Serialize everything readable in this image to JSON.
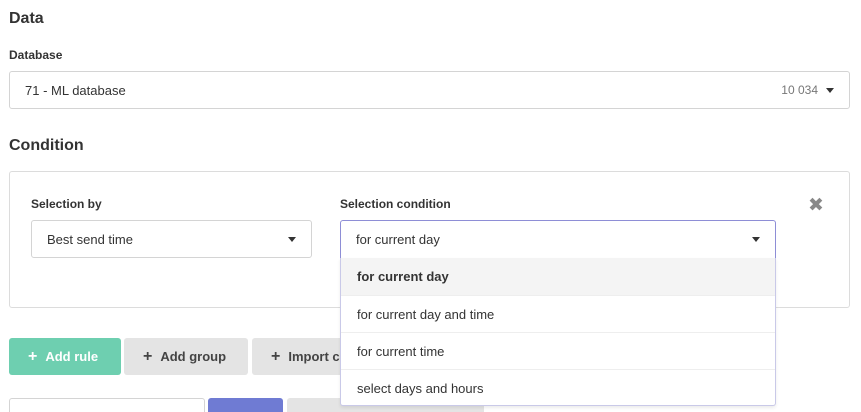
{
  "data_section": {
    "title": "Data",
    "database_label": "Database",
    "database_value": "71 - ML database",
    "database_count": "10 034"
  },
  "condition_section": {
    "title": "Condition",
    "selection_by_label": "Selection by",
    "selection_by_value": "Best send time",
    "selection_condition_label": "Selection condition",
    "selection_condition_value": "for current day",
    "options": [
      "for current day",
      "for current day and time",
      "for current time",
      "select days and hours"
    ]
  },
  "actions": {
    "add_rule": "Add rule",
    "add_group": "Add group",
    "import": "Import c"
  },
  "colors": {
    "accent_green": "#6ecfb0",
    "accent_blue": "#6f7bd3"
  }
}
